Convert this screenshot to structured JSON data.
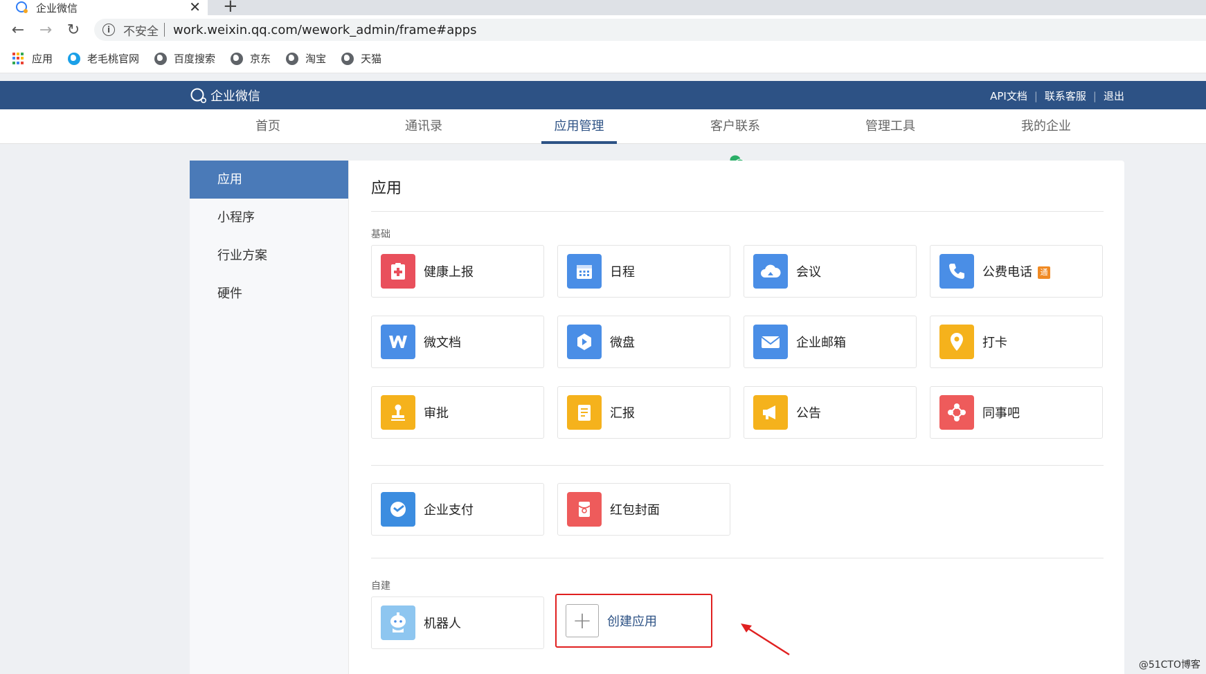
{
  "browser": {
    "tab_title": "企业微信",
    "tab_close": "✕",
    "new_tab": "+",
    "insecure_label": "不安全",
    "url": "work.weixin.qq.com/wework_admin/frame#apps",
    "bookmarks": [
      "应用",
      "老毛桃官网",
      "百度搜索",
      "京东",
      "淘宝",
      "天猫"
    ]
  },
  "header": {
    "logo_text": "企业微信",
    "links": [
      "API文档",
      "联系客服",
      "退出"
    ]
  },
  "nav": {
    "items": [
      "首页",
      "通讯录",
      "应用管理",
      "客户联系",
      "管理工具",
      "我的企业"
    ],
    "active": "应用管理"
  },
  "sidebar": {
    "items": [
      "应用",
      "小程序",
      "行业方案",
      "硬件"
    ],
    "active": "应用"
  },
  "main": {
    "title": "应用",
    "section_basic": "基础",
    "basic_apps": [
      {
        "label": "健康上报",
        "icon": "health-report-icon",
        "color": "#e9505c"
      },
      {
        "label": "日程",
        "icon": "calendar-icon",
        "color": "#4a8ee6"
      },
      {
        "label": "会议",
        "icon": "meeting-cloud-icon",
        "color": "#4a8ee6"
      },
      {
        "label": "公费电话",
        "icon": "phone-icon",
        "color": "#4a8ee6",
        "badge": "通"
      },
      {
        "label": "微文档",
        "icon": "doc-w-icon",
        "color": "#4a8ee6"
      },
      {
        "label": "微盘",
        "icon": "drive-icon",
        "color": "#4a8ee6"
      },
      {
        "label": "企业邮箱",
        "icon": "mail-icon",
        "color": "#4a8ee6"
      },
      {
        "label": "打卡",
        "icon": "location-pin-icon",
        "color": "#f5b21c"
      },
      {
        "label": "审批",
        "icon": "approval-stamp-icon",
        "color": "#f5b21c"
      },
      {
        "label": "汇报",
        "icon": "report-doc-icon",
        "color": "#f5b21c"
      },
      {
        "label": "公告",
        "icon": "megaphone-icon",
        "color": "#f5b21c"
      },
      {
        "label": "同事吧",
        "icon": "colleague-network-icon",
        "color": "#ee5b5b"
      }
    ],
    "extra_apps": [
      {
        "label": "企业支付",
        "icon": "pay-icon",
        "color": "#3c8de0"
      },
      {
        "label": "红包封面",
        "icon": "red-packet-icon",
        "color": "#ee5b5b"
      }
    ],
    "section_custom": "自建",
    "custom_apps": [
      {
        "label": "机器人",
        "icon": "robot-icon",
        "color": "#8ec6f0"
      }
    ],
    "create_label": "创建应用",
    "create_icon": "+"
  },
  "watermark": "@51CTO博客"
}
